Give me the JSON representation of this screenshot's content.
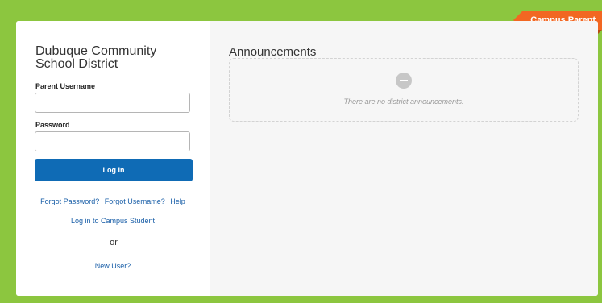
{
  "brand": {
    "product": "Campus Parent",
    "colors": {
      "background": "#8cc63f",
      "ribbon": "#f26722",
      "primary": "#0f6bb5",
      "link": "#1a5fa8"
    }
  },
  "login": {
    "district_name": "Dubuque Community School District",
    "username_label": "Parent Username",
    "username_value": "",
    "password_label": "Password",
    "password_value": "",
    "login_button": "Log In",
    "forgot_password": "Forgot Password?",
    "forgot_username": "Forgot Username?",
    "help": "Help",
    "campus_student_link": "Log in to Campus Student",
    "or": "or",
    "new_user": "New User?"
  },
  "announcements": {
    "title": "Announcements",
    "empty_icon": "no-entry-icon",
    "empty_message": "There are no district announcements."
  }
}
